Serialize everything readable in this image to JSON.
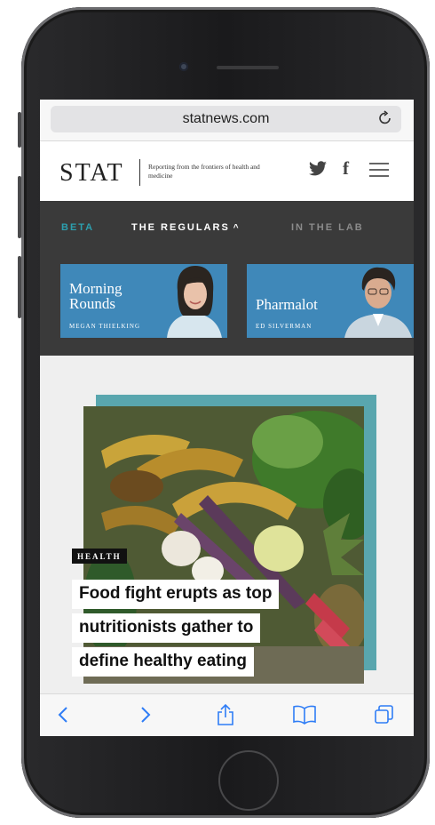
{
  "browser": {
    "url": "statnews.com",
    "reload_icon": "reload-icon"
  },
  "header": {
    "logo": "STAT",
    "tagline": "Reporting from the frontiers of health and medicine",
    "icons": [
      "twitter-icon",
      "facebook-icon",
      "menu-icon"
    ]
  },
  "nav": {
    "items": [
      {
        "label": "BETA"
      },
      {
        "label": "THE REGULARS"
      },
      {
        "label": "IN THE LAB"
      }
    ],
    "caret": "^"
  },
  "cards": [
    {
      "title_line1": "Morning",
      "title_line2": "Rounds",
      "author": "MEGAN THIELKING"
    },
    {
      "title_line1": "Pharmalot",
      "author": "ED SILVERMAN"
    }
  ],
  "article": {
    "tag": "HEALTH",
    "headline_lines": [
      "Food fight erupts as top",
      "nutritionists gather to",
      "define healthy eating"
    ]
  },
  "toolbar": {
    "icons": [
      "back-icon",
      "forward-icon",
      "share-icon",
      "bookmarks-icon",
      "tabs-icon"
    ]
  },
  "colors": {
    "accent": "#2c9fae",
    "card_blue": "#3f88b9",
    "teal": "#59a6ae",
    "ios_blue": "#2f7df6"
  }
}
